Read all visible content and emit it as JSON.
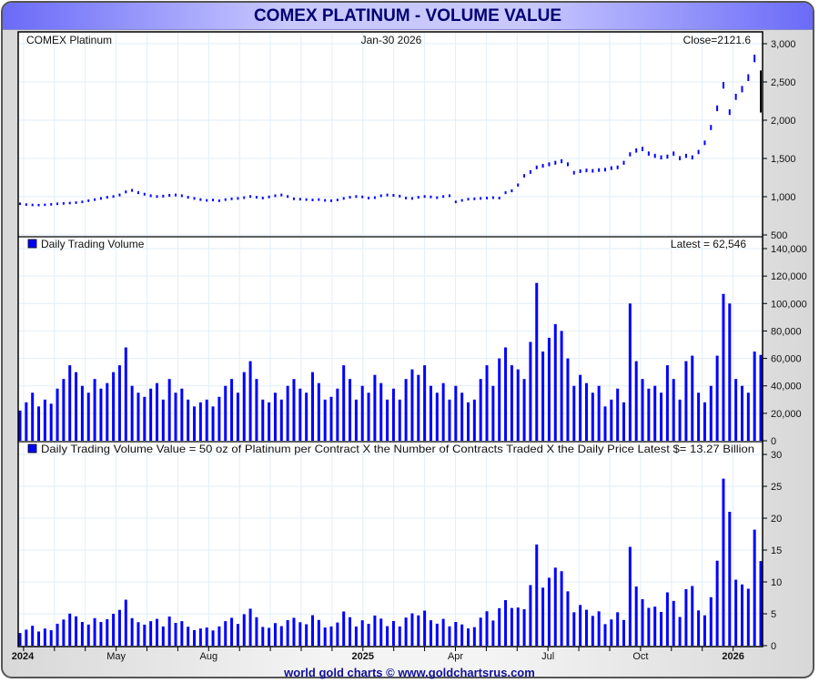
{
  "title": "COMEX PLATINUM - VOLUME VALUE",
  "footer": "world gold charts © www.goldchartsrus.com",
  "colors": {
    "series": "#0000ff",
    "grid": "#e2eef8",
    "title_text": "#000070"
  },
  "chart_data": [
    {
      "type": "bar",
      "name": "price",
      "title_left": "COMEX Platinum",
      "title_center": "Jan-30  2026",
      "title_right": "Close=2121.6",
      "ylim": [
        500,
        3000
      ],
      "yticks": [
        "3,000",
        "2,500",
        "2,000",
        "1,500",
        "1,000",
        "500"
      ],
      "ytick_values": [
        3000,
        2500,
        2000,
        1500,
        1000,
        500
      ],
      "values": [
        905,
        895,
        890,
        888,
        892,
        898,
        905,
        910,
        915,
        920,
        930,
        945,
        960,
        975,
        990,
        1000,
        1020,
        1060,
        1080,
        1050,
        1030,
        1010,
        1000,
        1005,
        1015,
        1020,
        1010,
        990,
        975,
        960,
        950,
        955,
        945,
        960,
        970,
        975,
        985,
        1000,
        990,
        980,
        995,
        1010,
        1020,
        1000,
        970,
        965,
        960,
        955,
        960,
        950,
        945,
        955,
        975,
        990,
        1000,
        995,
        980,
        985,
        1010,
        1020,
        1015,
        1005,
        980,
        975,
        990,
        1000,
        995,
        985,
        1000,
        1010,
        930,
        950,
        965,
        970,
        975,
        980,
        985,
        980,
        1050,
        1075,
        1150,
        1270,
        1320,
        1380,
        1400,
        1420,
        1440,
        1460,
        1420,
        1310,
        1330,
        1340,
        1335,
        1345,
        1350,
        1370,
        1380,
        1440,
        1550,
        1600,
        1620,
        1560,
        1530,
        1510,
        1520,
        1560,
        1500,
        1530,
        1510,
        1580,
        1700,
        1900,
        2150,
        2450,
        2100,
        2300,
        2400,
        2550,
        2800,
        2121.6
      ]
    },
    {
      "type": "bar",
      "name": "volume",
      "legend": "Daily Trading Volume",
      "title_right": "Latest = 62,546",
      "ylim": [
        0,
        140000
      ],
      "yticks": [
        "140,000",
        "120,000",
        "100,000",
        "80,000",
        "60,000",
        "40,000",
        "20,000",
        "0"
      ],
      "ytick_values": [
        140000,
        120000,
        100000,
        80000,
        60000,
        40000,
        20000,
        0
      ],
      "values": [
        22000,
        28000,
        35000,
        25000,
        30000,
        27000,
        38000,
        45000,
        55000,
        50000,
        40000,
        35000,
        45000,
        38000,
        42000,
        50000,
        55000,
        68000,
        40000,
        35000,
        32000,
        38000,
        42000,
        30000,
        45000,
        35000,
        38000,
        30000,
        25000,
        28000,
        30000,
        25000,
        32000,
        40000,
        45000,
        35000,
        50000,
        58000,
        45000,
        30000,
        28000,
        35000,
        30000,
        40000,
        45000,
        38000,
        35000,
        50000,
        42000,
        30000,
        32000,
        38000,
        55000,
        45000,
        30000,
        40000,
        35000,
        48000,
        42000,
        30000,
        38000,
        30000,
        45000,
        52000,
        48000,
        55000,
        40000,
        35000,
        42000,
        30000,
        40000,
        35000,
        28000,
        30000,
        45000,
        55000,
        40000,
        60000,
        68000,
        55000,
        52000,
        45000,
        72000,
        115000,
        65000,
        75000,
        85000,
        80000,
        60000,
        40000,
        48000,
        42000,
        35000,
        40000,
        25000,
        30000,
        38000,
        28000,
        100000,
        58000,
        45000,
        38000,
        40000,
        35000,
        55000,
        45000,
        30000,
        58000,
        62000,
        35000,
        28000,
        40000,
        62000,
        107000,
        100000,
        45000,
        40000,
        35000,
        65000,
        62546
      ]
    },
    {
      "type": "bar",
      "name": "volume_value",
      "legend": "Daily Trading Volume Value = 50 oz of Platinum per Contract X the Number of Contracts Traded X the Daily Price Latest $= 13.27 Billion",
      "ylim": [
        0,
        30
      ],
      "yticks": [
        "30",
        "25",
        "20",
        "15",
        "10",
        "5",
        "0"
      ],
      "ytick_values": [
        30,
        25,
        20,
        15,
        10,
        5,
        0
      ],
      "values": [
        1.99,
        2.51,
        3.12,
        2.22,
        2.68,
        2.42,
        3.44,
        4.1,
        5.03,
        4.6,
        3.72,
        3.31,
        4.32,
        3.71,
        4.16,
        5.0,
        5.61,
        7.21,
        4.32,
        3.68,
        3.3,
        3.84,
        4.2,
        3.02,
        4.57,
        3.57,
        3.84,
        2.97,
        2.44,
        2.69,
        2.85,
        2.39,
        3.02,
        3.84,
        4.37,
        3.41,
        4.93,
        5.8,
        4.46,
        2.94,
        2.79,
        3.54,
        3.06,
        4.0,
        4.37,
        3.67,
        3.36,
        4.78,
        4.03,
        2.85,
        3.02,
        3.63,
        5.36,
        4.46,
        3.0,
        3.98,
        3.43,
        4.73,
        4.24,
        3.06,
        3.86,
        3.02,
        4.41,
        5.07,
        4.75,
        5.5,
        3.98,
        3.45,
        4.2,
        3.03,
        3.72,
        3.33,
        2.7,
        2.91,
        4.39,
        5.39,
        3.94,
        5.88,
        7.14,
        5.91,
        5.98,
        5.72,
        9.5,
        15.87,
        9.1,
        10.65,
        12.24,
        11.68,
        8.52,
        5.24,
        6.38,
        5.63,
        4.67,
        5.38,
        3.38,
        4.11,
        5.24,
        4.03,
        15.5,
        9.28,
        7.29,
        5.93,
        6.12,
        5.29,
        8.36,
        7.02,
        4.5,
        8.87,
        9.36,
        5.53,
        4.76,
        7.6,
        13.33,
        26.2,
        21.0,
        10.35,
        9.6,
        8.93,
        18.2,
        13.27
      ]
    }
  ],
  "x_axis": {
    "unit": "months since Jan 2024",
    "range": [
      0.83,
      25.0
    ],
    "labels": [
      {
        "label": "2024",
        "month": 0,
        "year": true
      },
      {
        "label": "May",
        "month": 4
      },
      {
        "label": "Aug",
        "month": 7
      },
      {
        "label": "2025",
        "month": 12,
        "year": true
      },
      {
        "label": "Apr",
        "month": 15
      },
      {
        "label": "Jul",
        "month": 18
      },
      {
        "label": "Oct",
        "month": 21
      },
      {
        "label": "2026",
        "month": 24,
        "year": true
      }
    ]
  }
}
